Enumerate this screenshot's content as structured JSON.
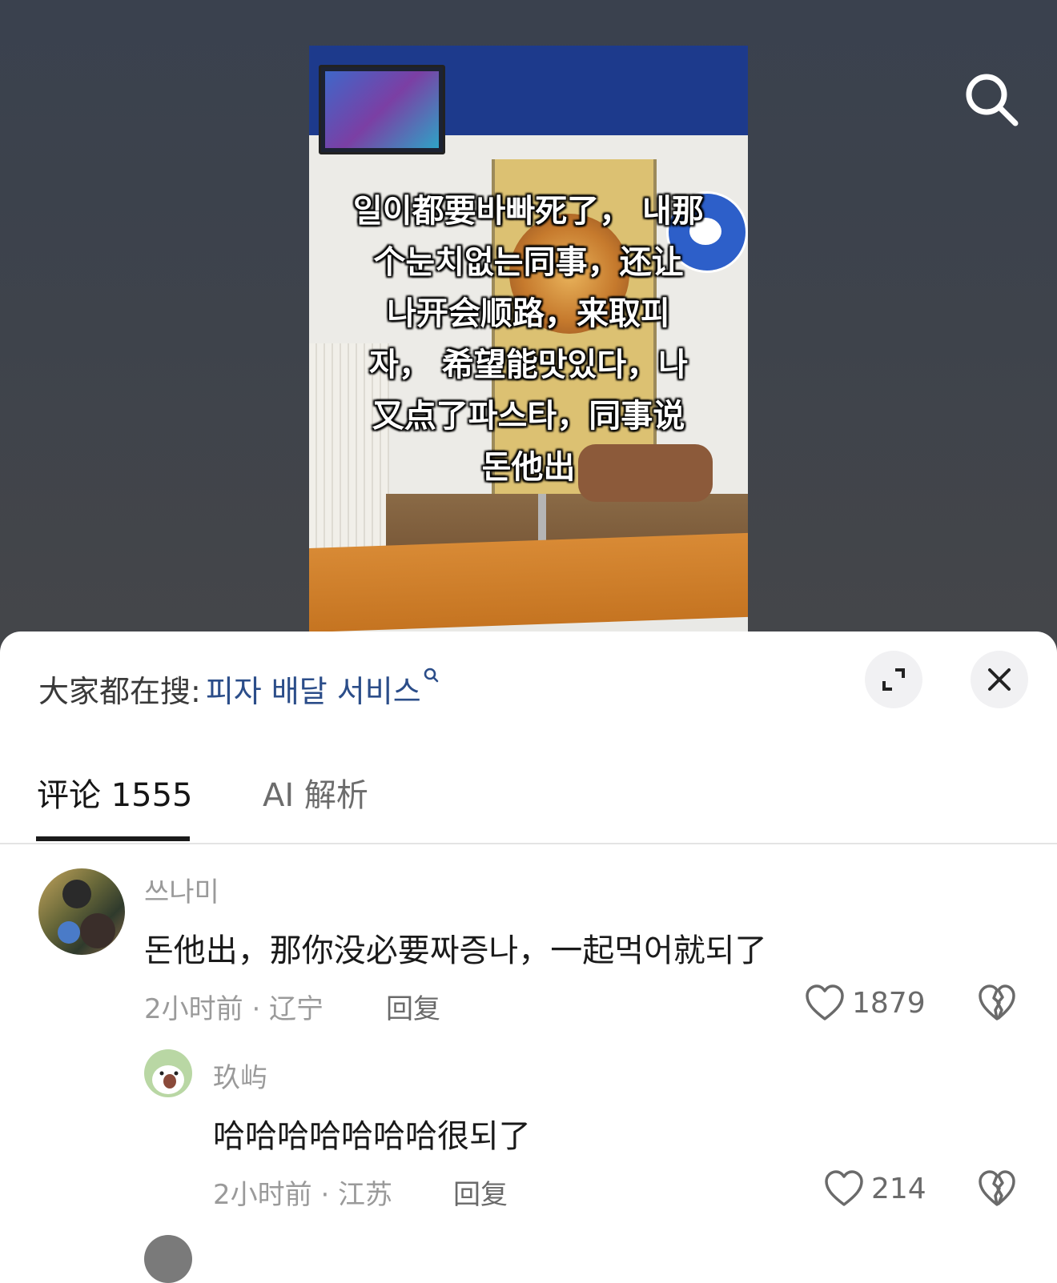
{
  "video": {
    "caption_lines": [
      "일이都要바빠死了， 내那",
      "个눈치없는同事，还让",
      "나开会顺路，来取피",
      "자， 希望能맛있다，나",
      "又点了파스타，同事说",
      "돈他出"
    ]
  },
  "trending": {
    "label": "大家都在搜:",
    "query": "피자 배달 서비스"
  },
  "tabs": {
    "comments_label": "评论 1555",
    "ai_label": "AI 解析"
  },
  "comments": [
    {
      "username": "쓰나미",
      "text": "돈他出，那你没必要짜증나，一起먹어就되了",
      "time_location": "2小时前 · 辽宁",
      "reply_label": "回复",
      "likes": "1879"
    },
    {
      "username": "玖屿",
      "text": "哈哈哈哈哈哈哈很되了",
      "time_location": "2小时前 · 江苏",
      "reply_label": "回复",
      "likes": "214"
    }
  ],
  "icons": {
    "search": "search-icon",
    "expand": "expand-icon",
    "close": "close-icon",
    "like": "heart-icon",
    "dislike": "broken-heart-icon"
  },
  "colors": {
    "link": "#2b4d89",
    "muted": "#9a9a9a",
    "sheet_bg": "#ffffff"
  }
}
